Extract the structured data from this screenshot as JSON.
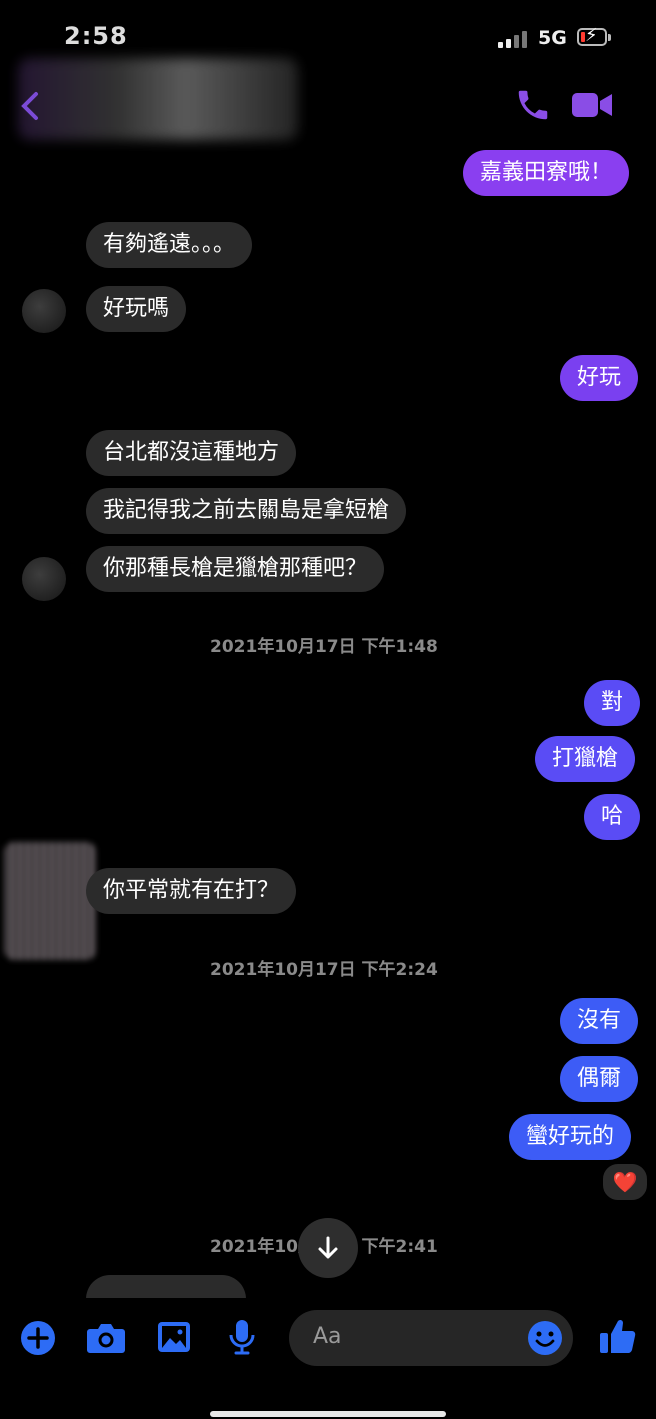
{
  "status_bar": {
    "time": "2:58",
    "network": "5G"
  },
  "colors": {
    "accent": "#7b4bd6",
    "blue": "#2d6cf5",
    "incoming": "#2b2b2b"
  },
  "header": {
    "back_icon": "chevron-left-icon",
    "call_icon": "phone-icon",
    "video_icon": "video-camera-icon"
  },
  "messages": [
    {
      "dir": "out",
      "text": "嘉義田寮哦！"
    },
    {
      "dir": "in",
      "text": "有夠遙遠。。。"
    },
    {
      "dir": "in",
      "text": "好玩嗎"
    },
    {
      "dir": "out",
      "text": "好玩"
    },
    {
      "dir": "in",
      "text": "台北都沒這種地方"
    },
    {
      "dir": "in",
      "text": "我記得我之前去關島是拿短槍"
    },
    {
      "dir": "in",
      "text": "你那種長槍是獵槍那種吧？"
    },
    {
      "dir": "out",
      "text": "對"
    },
    {
      "dir": "out",
      "text": "打獵槍"
    },
    {
      "dir": "out",
      "text": "哈"
    },
    {
      "dir": "in",
      "text": "你平常就有在打？"
    },
    {
      "dir": "out",
      "text": "沒有"
    },
    {
      "dir": "out",
      "text": "偶爾"
    },
    {
      "dir": "out",
      "text": "蠻好玩的",
      "reaction": "❤️"
    }
  ],
  "timestamps": [
    "2021年10月17日 下午1:48",
    "2021年10月17日 下午2:24",
    "2021年10月17日 下午2:41"
  ],
  "composer": {
    "placeholder": "Aa",
    "icons": [
      "plus-icon",
      "camera-icon",
      "image-icon",
      "microphone-icon",
      "emoji-icon",
      "thumbs-up-icon"
    ]
  }
}
